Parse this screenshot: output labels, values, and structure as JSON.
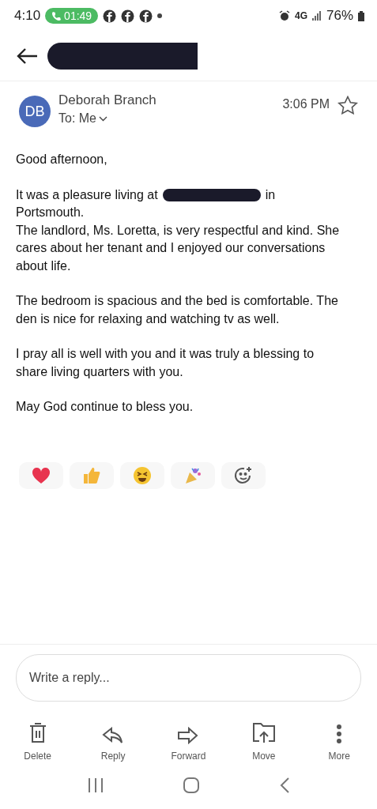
{
  "status_bar": {
    "time": "4:10",
    "call_timer": "01:49",
    "network": "4G",
    "battery": "76%"
  },
  "header": {
    "title_redacted": true
  },
  "message": {
    "sender_initials": "DB",
    "sender": "Deborah Branch",
    "recipient": "To: Me",
    "time": "3:06 PM",
    "starred": false
  },
  "body": {
    "greeting": "Good afternoon,",
    "address_line": {
      "before": "It was a pleasure living at",
      "after": "in"
    },
    "paragraphs": [
      "Portsmouth.\nThe landlord, Ms. Loretta, is very respectful and kind. She cares about her tenant and I enjoyed our conversations about life.",
      "The bedroom is spacious and the bed is comfortable. The den is nice for relaxing and watching tv as well.",
      "I pray all is well with you and it was truly a blessing to share living quarters with you.",
      "May God continue to bless you."
    ]
  },
  "reactions": [
    {
      "kind": "heart"
    },
    {
      "kind": "thumbs"
    },
    {
      "kind": "laugh"
    },
    {
      "kind": "party"
    },
    {
      "kind": "add"
    }
  ],
  "reply": {
    "placeholder": "Write a reply..."
  },
  "actions": [
    {
      "kind": "delete",
      "label": "Delete"
    },
    {
      "kind": "reply",
      "label": "Reply"
    },
    {
      "kind": "forward",
      "label": "Forward"
    },
    {
      "kind": "move",
      "label": "Move"
    },
    {
      "kind": "more",
      "label": "More"
    }
  ]
}
